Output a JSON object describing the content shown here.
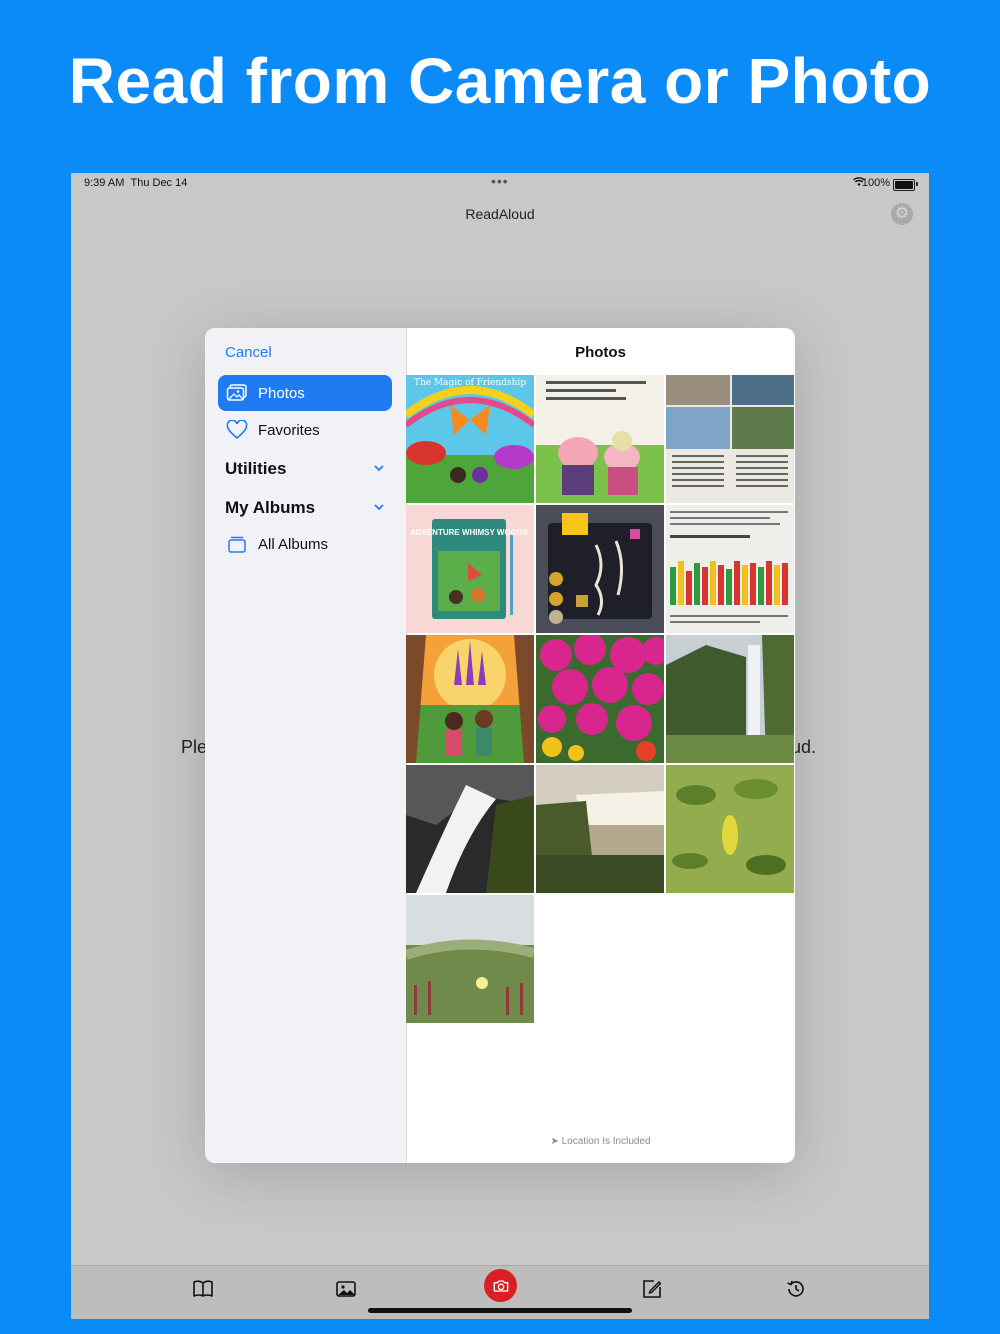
{
  "headline": "Read from Camera or Photo",
  "status": {
    "time": "9:39 AM",
    "date": "Thu Dec 14",
    "battery": "100%"
  },
  "nav": {
    "title": "ReadAloud"
  },
  "background_text": {
    "left": "Ple",
    "right": "ud."
  },
  "picker": {
    "cancel": "Cancel",
    "title": "Photos",
    "sidebar": [
      {
        "label": "Photos",
        "icon": "photos-icon",
        "selected": true
      },
      {
        "label": "Favorites",
        "icon": "heart-icon",
        "selected": false
      }
    ],
    "sections": [
      {
        "label": "Utilities",
        "icon": "chevron-down-icon"
      },
      {
        "label": "My Albums",
        "icon": "chevron-down-icon"
      }
    ],
    "albums": [
      {
        "label": "All Albums",
        "icon": "albums-icon"
      }
    ],
    "photo_captions": [
      "The Magic of Friendship",
      "ADVENTURE WHIMSY WOODS"
    ],
    "footer": "Location Is Included"
  },
  "tabs": [
    {
      "name": "book-icon"
    },
    {
      "name": "image-icon"
    },
    {
      "name": "camera-icon",
      "selected": true
    },
    {
      "name": "edit-icon"
    },
    {
      "name": "history-icon"
    }
  ],
  "colors": {
    "background": "#0a8bf8",
    "accent": "#1f7cf0",
    "camera": "#d91f22"
  }
}
